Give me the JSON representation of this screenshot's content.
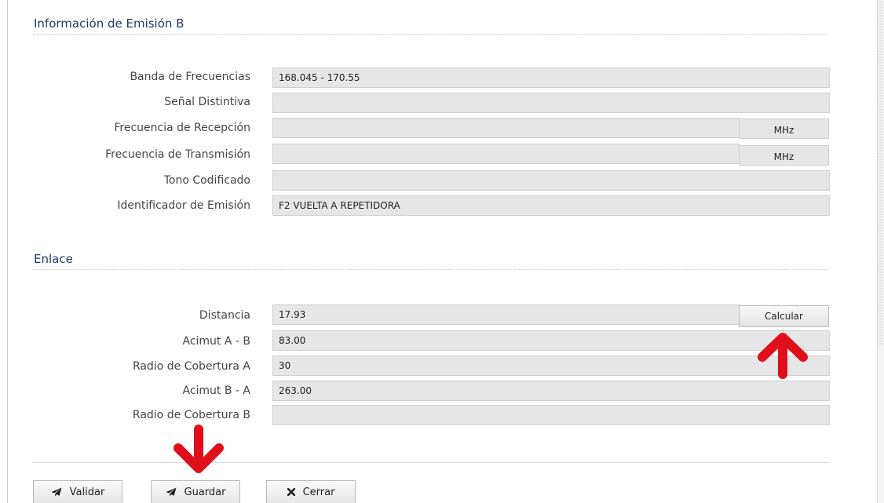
{
  "emision_b": {
    "title": "Información de Emisión B",
    "fields": [
      {
        "label": "Banda de Frecuencias",
        "value": "168.045 - 170.55"
      },
      {
        "label": "Señal Distintiva",
        "value": ""
      },
      {
        "label": "Frecuencia de Recepción",
        "value": "",
        "unit": "MHz"
      },
      {
        "label": "Frecuencia de Transmisión",
        "value": "",
        "unit": "MHz"
      },
      {
        "label": "Tono Codificado",
        "value": ""
      },
      {
        "label": "Identificador de Emisión",
        "value": "F2 VUELTA A REPETIDORA"
      }
    ]
  },
  "enlace": {
    "title": "Enlace",
    "calcular_label": "Calcular",
    "fields": [
      {
        "label": "Distancia",
        "value": "17.93"
      },
      {
        "label": "Acimut A - B",
        "value": "83.00"
      },
      {
        "label": "Radio de Cobertura A",
        "value": "30"
      },
      {
        "label": "Acimut B - A",
        "value": "263.00"
      },
      {
        "label": "Radio de Cobertura B",
        "value": ""
      }
    ]
  },
  "footer": {
    "validar_label": "Validar",
    "guardar_label": "Guardar",
    "cerrar_label": "Cerrar"
  },
  "colors": {
    "section_title": "#1f3a64",
    "field_bg": "#e6e6e6",
    "annotation_arrow": "#e0101a"
  },
  "icons": {
    "validar": "paper-plane-icon",
    "guardar": "paper-plane-icon",
    "cerrar": "close-icon",
    "annotations": [
      "red-arrow-up-icon",
      "red-arrow-down-icon"
    ]
  }
}
